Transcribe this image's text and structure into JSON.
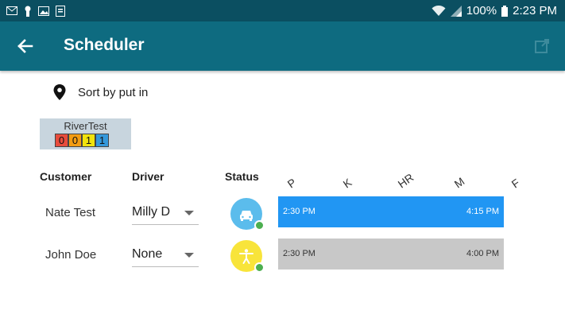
{
  "statusbar": {
    "battery": "100%",
    "time": "2:23 PM"
  },
  "appbar": {
    "title": "Scheduler",
    "back_icon": "arrow-left-icon",
    "action_icon": "open-external-icon"
  },
  "sort": {
    "icon": "location-pin-icon",
    "label": "Sort by put in"
  },
  "river": {
    "name": "RiverTest",
    "counts": [
      {
        "value": "0",
        "color": "#e74c3c"
      },
      {
        "value": "0",
        "color": "#f39c12"
      },
      {
        "value": "1",
        "color": "#f1e30c"
      },
      {
        "value": "1",
        "color": "#3498db"
      }
    ]
  },
  "table": {
    "headers": {
      "customer": "Customer",
      "driver": "Driver",
      "status": "Status"
    },
    "timeline_labels": [
      "P",
      "K",
      "HR",
      "M",
      "F"
    ],
    "rows": [
      {
        "customer": "Nate Test",
        "driver": "Milly D",
        "status_icon": "car-icon",
        "status_color": "#5bbcec",
        "bar_start": "2:30 PM",
        "bar_end": "4:15 PM",
        "bar_color": "#2196f3",
        "bar_text_color": "#ffffff"
      },
      {
        "customer": "John Doe",
        "driver": "None",
        "status_icon": "person-icon",
        "status_color": "#f8e43a",
        "bar_start": "2:30 PM",
        "bar_end": "4:00 PM",
        "bar_color": "#c8c8c8",
        "bar_text_color": "#333333"
      }
    ]
  }
}
